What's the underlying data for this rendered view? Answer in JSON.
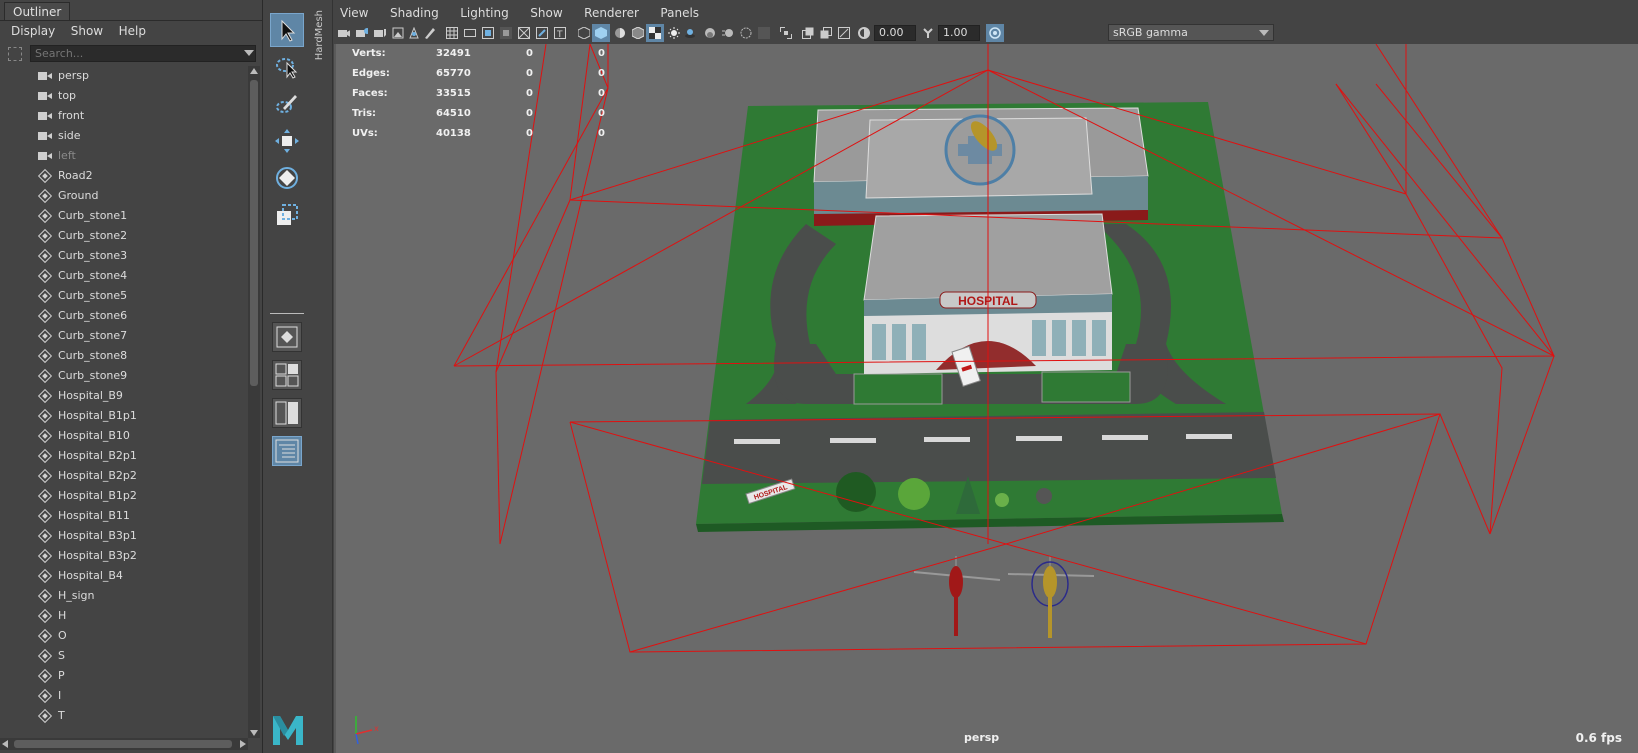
{
  "outliner": {
    "tab_label": "Outliner",
    "menu": [
      "Display",
      "Show",
      "Help"
    ],
    "search_placeholder": "Search...",
    "items": [
      {
        "label": "persp",
        "type": "camera",
        "dim": false
      },
      {
        "label": "top",
        "type": "camera",
        "dim": false
      },
      {
        "label": "front",
        "type": "camera",
        "dim": false
      },
      {
        "label": "side",
        "type": "camera",
        "dim": false
      },
      {
        "label": "left",
        "type": "camera",
        "dim": true
      },
      {
        "label": "Road2",
        "type": "mesh",
        "dim": false
      },
      {
        "label": "Ground",
        "type": "mesh",
        "dim": false
      },
      {
        "label": "Curb_stone1",
        "type": "mesh",
        "dim": false
      },
      {
        "label": "Curb_stone2",
        "type": "mesh",
        "dim": false
      },
      {
        "label": "Curb_stone3",
        "type": "mesh",
        "dim": false
      },
      {
        "label": "Curb_stone4",
        "type": "mesh",
        "dim": false
      },
      {
        "label": "Curb_stone5",
        "type": "mesh",
        "dim": false
      },
      {
        "label": "Curb_stone6",
        "type": "mesh",
        "dim": false
      },
      {
        "label": "Curb_stone7",
        "type": "mesh",
        "dim": false
      },
      {
        "label": "Curb_stone8",
        "type": "mesh",
        "dim": false
      },
      {
        "label": "Curb_stone9",
        "type": "mesh",
        "dim": false
      },
      {
        "label": "Hospital_B9",
        "type": "mesh",
        "dim": false
      },
      {
        "label": "Hospital_B1p1",
        "type": "mesh",
        "dim": false
      },
      {
        "label": "Hospital_B10",
        "type": "mesh",
        "dim": false
      },
      {
        "label": "Hospital_B2p1",
        "type": "mesh",
        "dim": false
      },
      {
        "label": "Hospital_B2p2",
        "type": "mesh",
        "dim": false
      },
      {
        "label": "Hospital_B1p2",
        "type": "mesh",
        "dim": false
      },
      {
        "label": "Hospital_B11",
        "type": "mesh",
        "dim": false
      },
      {
        "label": "Hospital_B3p1",
        "type": "mesh",
        "dim": false
      },
      {
        "label": "Hospital_B3p2",
        "type": "mesh",
        "dim": false
      },
      {
        "label": "Hospital_B4",
        "type": "mesh",
        "dim": false
      },
      {
        "label": "H_sign",
        "type": "mesh",
        "dim": false
      },
      {
        "label": "H",
        "type": "mesh",
        "dim": false
      },
      {
        "label": "O",
        "type": "mesh",
        "dim": false
      },
      {
        "label": "S",
        "type": "mesh",
        "dim": false
      },
      {
        "label": "P",
        "type": "mesh",
        "dim": false
      },
      {
        "label": "I",
        "type": "mesh",
        "dim": false
      },
      {
        "label": "T",
        "type": "mesh",
        "dim": false
      }
    ]
  },
  "toolbox": {
    "tools": [
      "select-tool",
      "lasso-tool",
      "paint-select-tool",
      "move-tool",
      "rotate-tool",
      "scale-tool"
    ],
    "hardmesh_label": "HardMesh"
  },
  "panel": {
    "menu": [
      "View",
      "Shading",
      "Lighting",
      "Show",
      "Renderer",
      "Panels"
    ],
    "exposure": "0.00",
    "gamma": "1.00",
    "color_space": "sRGB gamma"
  },
  "hud": {
    "rows": [
      {
        "key": "Verts:",
        "v1": "32491",
        "v2": "0",
        "v3": "0"
      },
      {
        "key": "Edges:",
        "v1": "65770",
        "v2": "0",
        "v3": "0"
      },
      {
        "key": "Faces:",
        "v1": "33515",
        "v2": "0",
        "v3": "0"
      },
      {
        "key": "Tris:",
        "v1": "64510",
        "v2": "0",
        "v3": "0"
      },
      {
        "key": "UVs:",
        "v1": "40138",
        "v2": "0",
        "v3": "0"
      }
    ],
    "camera_name": "persp",
    "fps": "0.6 fps"
  },
  "scene": {
    "hospital_sign": "HOSPITAL",
    "billboard_sign": "HOSPITAL"
  },
  "colors": {
    "accent": "#5f86a6",
    "viewport_bg": "#6a6a6a",
    "wire": "#e01010",
    "grass": "#2f7a34",
    "road": "#4a4d4b"
  }
}
